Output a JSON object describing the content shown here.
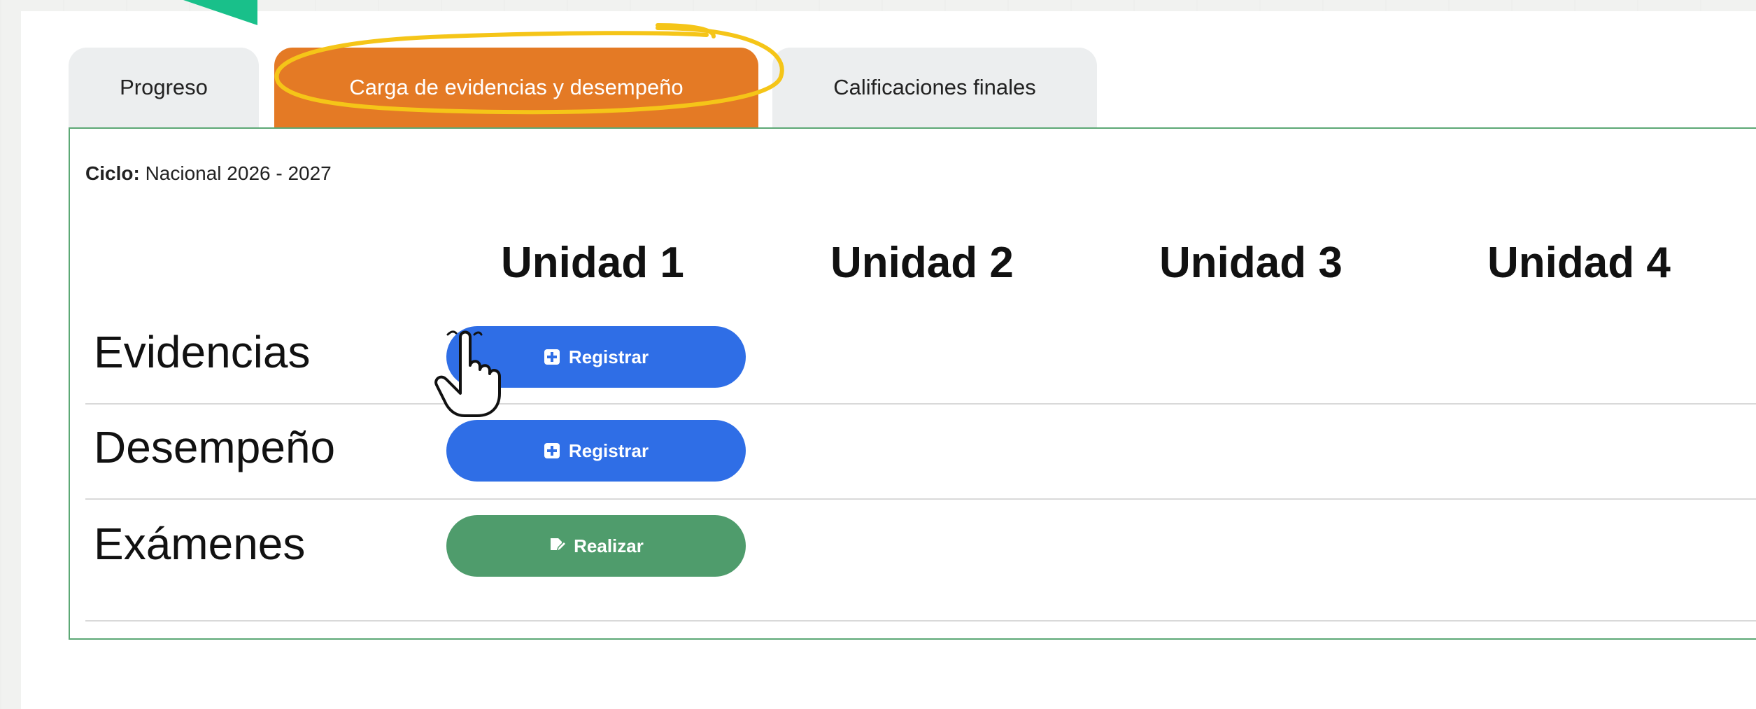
{
  "tabs": [
    {
      "label": "Progreso",
      "active": false
    },
    {
      "label": "Carga de evidencias y desempeño",
      "active": true
    },
    {
      "label": "Calificaciones finales",
      "active": false
    }
  ],
  "ciclo": {
    "label": "Ciclo:",
    "value": "Nacional 2026 - 2027"
  },
  "units": [
    "Unidad 1",
    "Unidad 2",
    "Unidad 3",
    "Unidad 4"
  ],
  "rows": [
    {
      "label": "Evidencias",
      "button": "Registrar",
      "button_icon": "plus-square-icon"
    },
    {
      "label": "Desempeño",
      "button": "Registrar",
      "button_icon": "plus-square-icon"
    },
    {
      "label": "Exámenes",
      "button": "Realizar",
      "button_icon": "edit-document-icon"
    }
  ],
  "colors": {
    "active_tab": "#e47a25",
    "highlight_ring": "#f5c518",
    "arrow": "#19c08a",
    "blue_button": "#2f6ee6",
    "green_button": "#4f9c6c",
    "panel_border": "#5ca875"
  }
}
